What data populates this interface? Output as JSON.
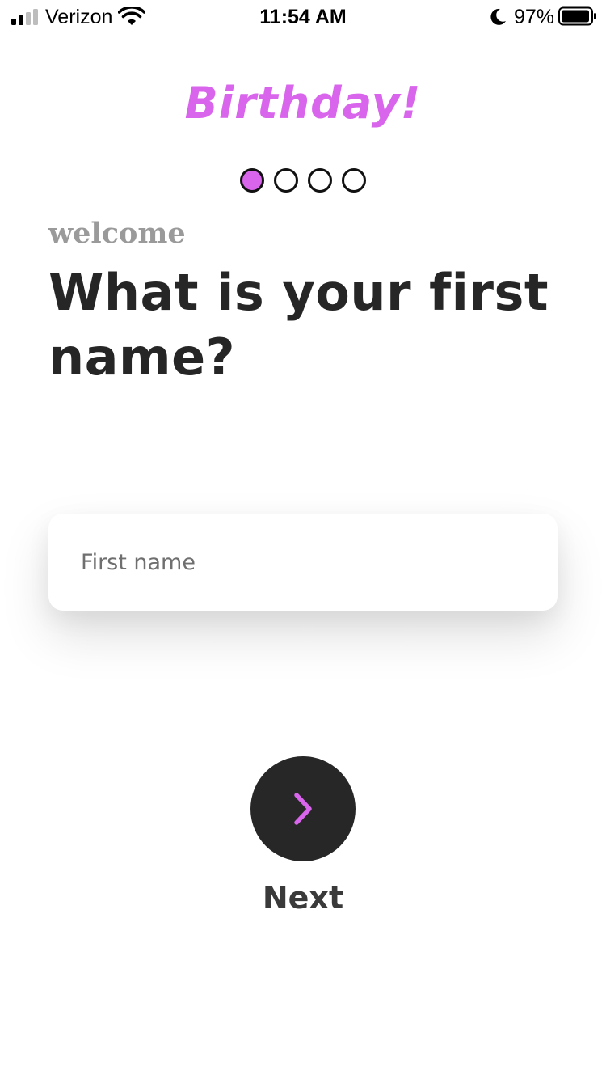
{
  "status_bar": {
    "carrier": "Verizon",
    "time": "11:54 AM",
    "battery_percent": "97%",
    "icons": [
      "signal-icon",
      "wifi-icon",
      "moon-icon",
      "battery-icon"
    ]
  },
  "brand": {
    "title": "Birthday!"
  },
  "steps": {
    "total": 4,
    "current": 1
  },
  "form": {
    "eyebrow": "welcome",
    "question": "What is your first name?",
    "first_name_placeholder": "First name",
    "first_name_value": ""
  },
  "next": {
    "label": "Next",
    "icon": "chevron-right-icon"
  },
  "colors": {
    "accent": "#d865ec",
    "dark": "#272727",
    "muted": "#9a9a9a"
  }
}
